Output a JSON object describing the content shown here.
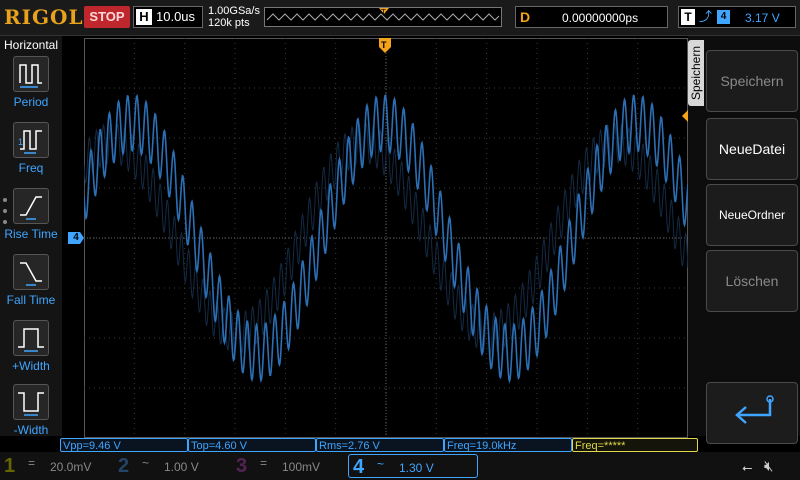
{
  "top": {
    "brand": "RIGOL",
    "run_state": "STOP",
    "horizontal_letter": "H",
    "timebase": "10.0us",
    "sample_rate": "1.00GSa/s",
    "memory_depth": "120k pts",
    "trigger_pos_marker": "T",
    "delay_letter": "D",
    "delay_value": "0.00000000ps",
    "trigger_letter": "T",
    "trigger_edge": "rising-edge-icon",
    "trigger_source": "4",
    "trigger_level": "3.17 V"
  },
  "left": {
    "title": "Horizontal",
    "items": [
      {
        "label": "Period",
        "icon": "period-icon"
      },
      {
        "label": "Freq",
        "icon": "frequency-icon"
      },
      {
        "label": "Rise Time",
        "icon": "rise-time-icon"
      },
      {
        "label": "Fall Time",
        "icon": "fall-time-icon"
      },
      {
        "label": "+Width",
        "icon": "positive-width-icon"
      },
      {
        "label": "-Width",
        "icon": "negative-width-icon"
      }
    ]
  },
  "scope": {
    "ch4_marker": "4",
    "trigger_marker": "T"
  },
  "right": {
    "menu_title": "Speichern",
    "softkeys": [
      {
        "label": "Speichern",
        "enabled": false
      },
      {
        "label": "NeueDatei",
        "enabled": true
      },
      {
        "label": "NeueOrdner",
        "enabled": true
      },
      {
        "label": "Löschen",
        "enabled": false
      },
      {
        "label": "",
        "icon": "enter-icon",
        "enabled": true
      }
    ]
  },
  "measurements": [
    {
      "text": "Vpp=9.46 V"
    },
    {
      "text": "Top=4.60 V"
    },
    {
      "text": "Rms=2.76 V"
    },
    {
      "text": "Freq=19.0kHz"
    },
    {
      "text": "Freq=*****"
    }
  ],
  "channels": [
    {
      "num": "1",
      "coupling": "=",
      "scale": "20.0mV",
      "color": "#666600"
    },
    {
      "num": "2",
      "coupling": "~",
      "scale": "1.00 V",
      "color": "#224466"
    },
    {
      "num": "3",
      "coupling": "=",
      "scale": "100mV",
      "color": "#552255"
    },
    {
      "num": "4",
      "coupling": "~",
      "scale": "1.30 V",
      "color": "#3fa5ff"
    }
  ],
  "status": {
    "usb_icon": "usb-icon",
    "speaker_icon": "speaker-muted-icon"
  },
  "colors": {
    "ch4": "#3fa5ff",
    "trigger": "#f5a31a",
    "stop": "#c0272d",
    "grid": "#3a3a3a"
  }
}
